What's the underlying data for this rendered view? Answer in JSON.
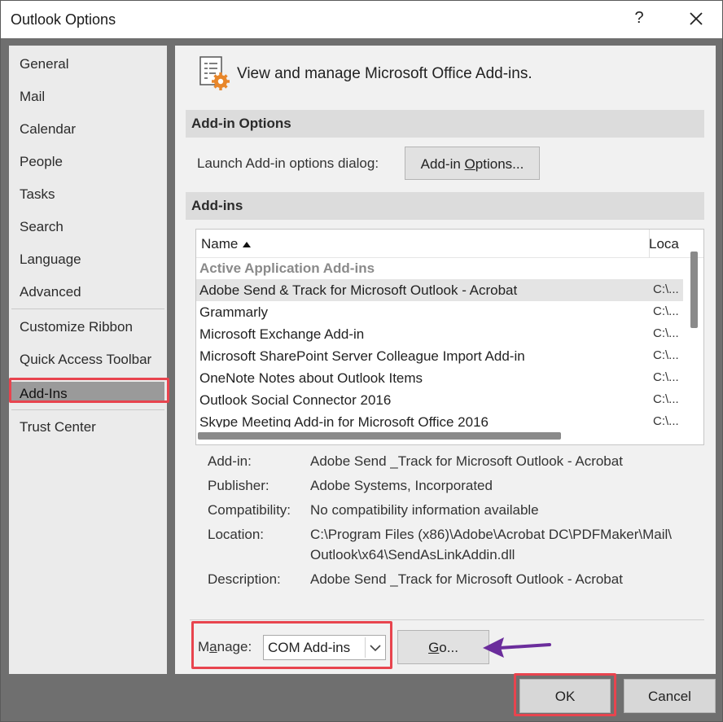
{
  "window": {
    "title": "Outlook Options",
    "help_glyph": "?",
    "close_icon": "close-icon"
  },
  "sidebar": {
    "items": [
      {
        "label": "General"
      },
      {
        "label": "Mail"
      },
      {
        "label": "Calendar"
      },
      {
        "label": "People"
      },
      {
        "label": "Tasks"
      },
      {
        "label": "Search"
      },
      {
        "label": "Language"
      },
      {
        "label": "Advanced"
      },
      {
        "label": "Customize Ribbon"
      },
      {
        "label": "Quick Access Toolbar"
      },
      {
        "label": "Add-Ins",
        "active": true
      },
      {
        "label": "Trust Center"
      }
    ]
  },
  "main": {
    "header": "View and manage Microsoft Office Add-ins.",
    "addin_options_section": "Add-in Options",
    "launch_label": "Launch Add-in options dialog:",
    "addin_options_button_pre": "Add-in ",
    "addin_options_button_ul": "O",
    "addin_options_button_post": "ptions...",
    "addins_section": "Add-ins",
    "list": {
      "col_name": "Name",
      "col_location": "Loca",
      "rows": [
        {
          "name": "Active Application Add-ins",
          "location": "",
          "group": true
        },
        {
          "name": "Adobe Send & Track for Microsoft Outlook - Acrobat",
          "location": "C:\\...",
          "selected": true
        },
        {
          "name": "Grammarly",
          "location": "C:\\..."
        },
        {
          "name": "Microsoft Exchange Add-in",
          "location": "C:\\..."
        },
        {
          "name": "Microsoft SharePoint Server Colleague Import Add-in",
          "location": "C:\\..."
        },
        {
          "name": "OneNote Notes about Outlook Items",
          "location": "C:\\..."
        },
        {
          "name": "Outlook Social Connector 2016",
          "location": "C:\\..."
        },
        {
          "name": "Skype Meeting Add-in for Microsoft Office 2016",
          "location": "C:\\..."
        }
      ]
    },
    "details": {
      "addin_label": "Add-in:",
      "addin_value": "Adobe Send _Track for Microsoft Outlook - Acrobat",
      "publisher_label": "Publisher:",
      "publisher_value": "Adobe Systems, Incorporated",
      "compat_label": "Compatibility:",
      "compat_value": "No compatibility information available",
      "location_label": "Location:",
      "location_value_1": "C:\\Program Files (x86)\\Adobe\\Acrobat DC\\PDFMaker\\Mail\\",
      "location_value_2": "Outlook\\x64\\SendAsLinkAddin.dll",
      "description_label": "Description:",
      "description_value": "Adobe Send _Track for Microsoft Outlook - Acrobat"
    },
    "manage": {
      "label_pre": "M",
      "label_ul": "a",
      "label_post": "nage:",
      "selected": "COM Add-ins",
      "go_ul": "G",
      "go_post": "o..."
    }
  },
  "footer": {
    "ok": "OK",
    "cancel": "Cancel"
  },
  "colors": {
    "highlight": "#e8444e",
    "arrow": "#6b2d9c"
  }
}
